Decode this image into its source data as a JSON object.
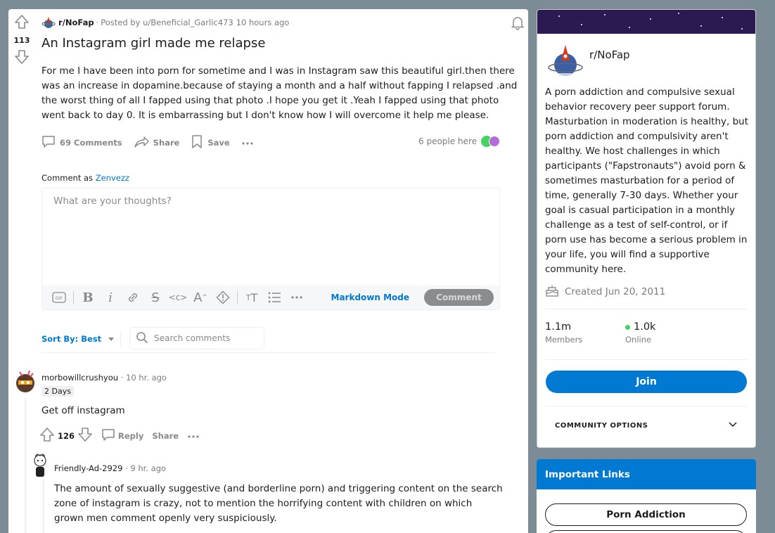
{
  "post": {
    "score": "113",
    "subreddit": "r/NoFap",
    "posted_by": "Posted by u/Beneficial_Garlic473",
    "time_ago": "10 hours ago",
    "title": "An Instagram girl made me relapse",
    "body": "For me I have been into porn for sometime and I was in Instagram saw this beautiful girl.then there was an increase in dopamine.because of staying a month and a half without fapping I relapsed .and the worst thing of all I fapped using that photo .I hope you get it .Yeah I fapped using that photo went back to day 0. It is embarrassing but I don't know how I will overcome it help me please.",
    "comments_label": "69 Comments",
    "share_label": "Share",
    "save_label": "Save",
    "people_here": "6 people here"
  },
  "composer": {
    "comment_as_prefix": "Comment as",
    "username": "Zenvezz",
    "placeholder": "What are your thoughts?",
    "markdown_mode": "Markdown Mode",
    "comment_button": "Comment"
  },
  "sort": {
    "label": "Sort By: Best",
    "search_placeholder": "Search comments"
  },
  "comments": [
    {
      "author": "morbowillcrushyou",
      "time": "10 hr. ago",
      "flair": "2 Days",
      "text": "Get off instagram",
      "score": "126",
      "reply_label": "Reply",
      "share_label": "Share"
    },
    {
      "author": "Friendly-Ad-2929",
      "time": "9 hr. ago",
      "text": "The amount of sexually suggestive (and borderline porn) and triggering content on the search zone of instagram is crazy, not to mention the horrifying content with children on which grown men comment openly very suspiciously."
    }
  ],
  "sidebar": {
    "community_name": "r/NoFap",
    "description": "A porn addiction and compulsive sexual behavior recovery peer support forum. Masturbation in moderation is healthy, but porn addiction and compulsivity aren't healthy. We host challenges in which participants (\"Fapstronauts\") avoid porn & sometimes masturbation for a period of time, generally 7-30 days. Whether your goal is casual participation in a monthly challenge as a test of self-control, or if porn use has become a serious problem in your life, you will find a supportive community here.",
    "created": "Created Jun 20, 2011",
    "members_count": "1.1m",
    "members_label": "Members",
    "online_count": "1.0k",
    "online_label": "Online",
    "join_label": "Join",
    "options_label": "COMMUNITY OPTIONS",
    "links_title": "Important Links",
    "links": [
      "Porn Addiction"
    ]
  },
  "colors": {
    "accent": "#0079d3",
    "online": "#46d160",
    "page_bg": "#7c8c96"
  }
}
